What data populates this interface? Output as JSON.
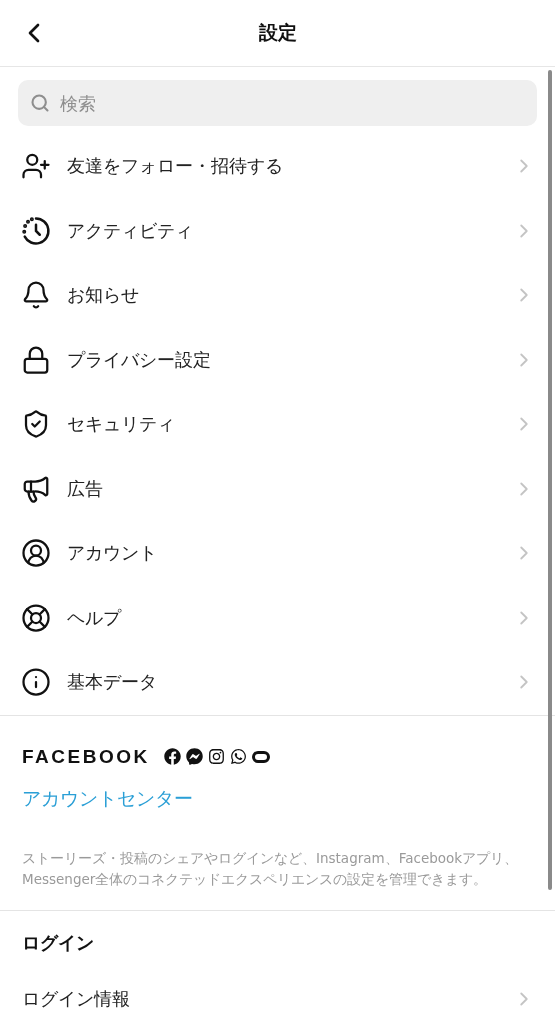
{
  "header": {
    "title": "設定"
  },
  "search": {
    "placeholder": "検索"
  },
  "menu": [
    {
      "label": "友達をフォロー・招待する"
    },
    {
      "label": "アクティビティ"
    },
    {
      "label": "お知らせ"
    },
    {
      "label": "プライバシー設定"
    },
    {
      "label": "セキュリティ"
    },
    {
      "label": "広告"
    },
    {
      "label": "アカウント"
    },
    {
      "label": "ヘルプ"
    },
    {
      "label": "基本データ"
    }
  ],
  "facebook_section": {
    "brand": "FACEBOOK",
    "link": "アカウントセンター",
    "description": "ストーリーズ・投稿のシェアやログインなど、Instagram、Facebookアプリ、Messenger全体のコネクテッドエクスペリエンスの設定を管理できます。"
  },
  "login_section": {
    "heading": "ログイン",
    "items": [
      {
        "label": "ログイン情報"
      }
    ]
  }
}
